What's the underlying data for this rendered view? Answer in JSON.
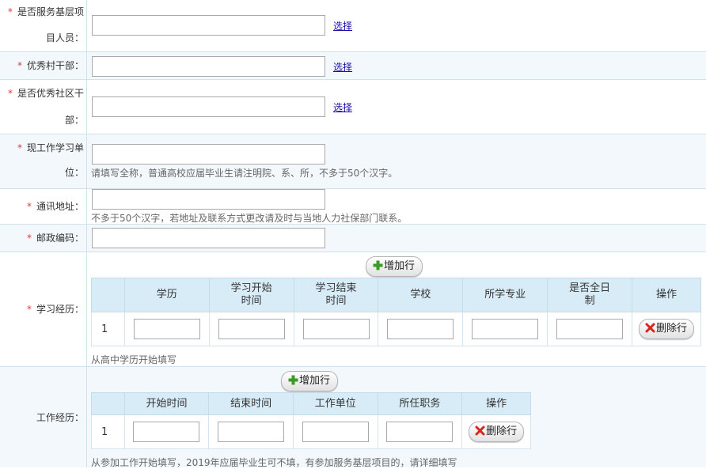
{
  "fields": {
    "service_base": {
      "required": "*",
      "label_line1": "是否服务基层项",
      "label_line2": "目人员：",
      "value": "",
      "link": "选择"
    },
    "excellent_village": {
      "required": "*",
      "label": "优秀村干部：",
      "value": "",
      "link": "选择"
    },
    "excellent_community": {
      "required": "*",
      "label_line1": "是否优秀社区干",
      "label_line2": "部：",
      "value": "",
      "link": "选择"
    },
    "work_unit": {
      "required": "*",
      "label_line1": "现工作学习单",
      "label_line2": "位：",
      "value": "",
      "hint": "请填写全称，普通高校应届毕业生请注明院、系、所，不多于50个汉字。"
    },
    "address": {
      "required": "*",
      "label": "通讯地址：",
      "value": "",
      "hint": "不多于50个汉字，若地址及联系方式更改请及时与当地人力社保部门联系。"
    },
    "postcode": {
      "required": "*",
      "label": "邮政编码：",
      "value": ""
    }
  },
  "study": {
    "required": "*",
    "label": "学习经历：",
    "add_button": "增加行",
    "headers": [
      "学历",
      "学习开始\n时间",
      "学习结束\n时间",
      "学校",
      "所学专业",
      "是否全日\n制",
      "操作"
    ],
    "rows": [
      {
        "index": "1",
        "delete_button": "删除行"
      }
    ],
    "hint": "从高中学历开始填写"
  },
  "work": {
    "label": "工作经历：",
    "add_button": "增加行",
    "headers": [
      "开始时间",
      "结束时间",
      "工作单位",
      "所任职务",
      "操作"
    ],
    "rows": [
      {
        "index": "1",
        "delete_button": "删除行"
      }
    ],
    "hint": "从参加工作开始填写，2019年应届毕业生可不填，有参加服务基层项目的，请详细填写"
  },
  "colors": {
    "required_star": "#e4393c",
    "row_alt_bg": "#f2f8fc",
    "table_header_bg": "#d8ecf7",
    "link": "#1a0dab",
    "add_icon": "#3a9d23",
    "delete_icon": "#d9261c"
  }
}
